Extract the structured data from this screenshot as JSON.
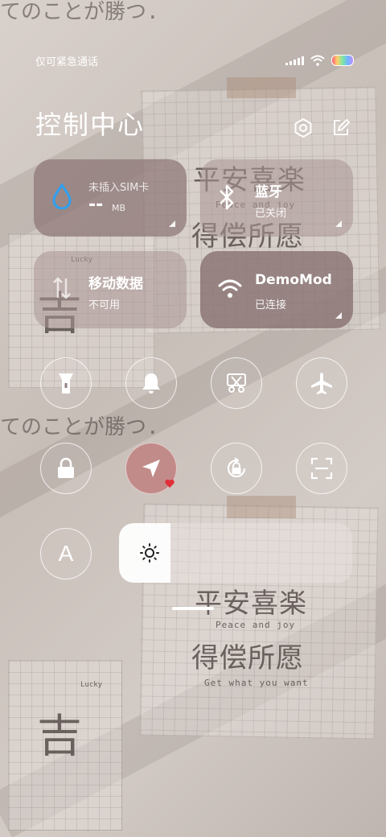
{
  "status_bar": {
    "carrier": "仅可紧急通话"
  },
  "header": {
    "title": "控制中心",
    "settings_icon": "gear-icon",
    "edit_icon": "edit-icon"
  },
  "tiles": {
    "sim": {
      "title": "未插入SIM卡",
      "value": "--",
      "unit": "MB",
      "icon": "water-drop-icon"
    },
    "bluetooth": {
      "title": "蓝牙",
      "status": "已关闭",
      "icon": "bluetooth-icon"
    },
    "mobile_data": {
      "title": "移动数据",
      "status": "不可用",
      "icon": "data-arrows-icon"
    },
    "wifi": {
      "title": "DemoMod",
      "status": "已连接",
      "icon": "wifi-icon"
    }
  },
  "toggles_row1": [
    {
      "name": "flashlight",
      "icon": "flashlight-icon",
      "active": false
    },
    {
      "name": "ringer",
      "icon": "bell-icon",
      "active": false
    },
    {
      "name": "screenshot",
      "icon": "scissors-icon",
      "active": false
    },
    {
      "name": "airplane",
      "icon": "airplane-icon",
      "active": false
    }
  ],
  "toggles_row2": [
    {
      "name": "lock",
      "icon": "lock-icon",
      "active": false
    },
    {
      "name": "location",
      "icon": "location-arrow-icon",
      "active": true
    },
    {
      "name": "rotation",
      "icon": "rotation-lock-icon",
      "active": false
    },
    {
      "name": "scanner",
      "icon": "scan-icon",
      "active": false
    }
  ],
  "auto_brightness": {
    "label": "A",
    "icon": "auto-brightness-icon"
  },
  "brightness": {
    "icon": "sun-icon",
    "level": 0.22
  },
  "wallpaper": {
    "top_text": "てのことが勝つ.",
    "mid_text": "てのことが勝つ.",
    "line1": "平安喜楽",
    "line2": "得偿所愿",
    "line3": "吉",
    "small1": "Peace and joy",
    "small2": "Get what you want",
    "lucky": "Lucky"
  },
  "colors": {
    "tile_dark": "#8a7676",
    "tile_light": "#aa9694",
    "active_toggle": "#be7878",
    "sim_icon": "#2ea0f0"
  }
}
